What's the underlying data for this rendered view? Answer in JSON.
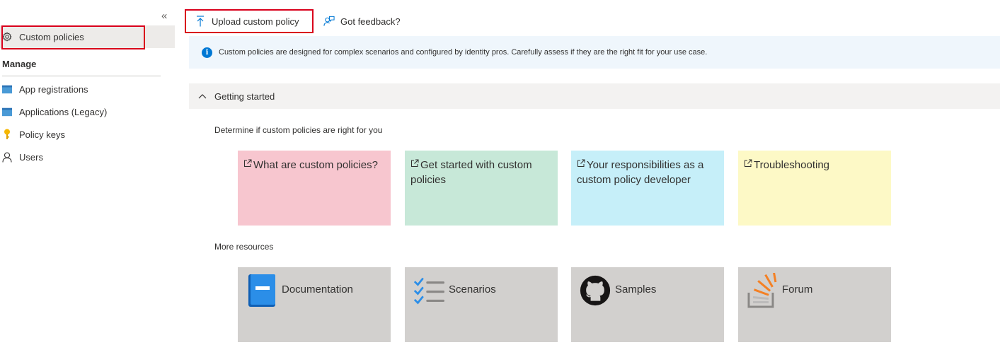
{
  "sidebar": {
    "collapse_label": "«",
    "active_item": {
      "label": "Custom policies",
      "icon": "gear-icon"
    },
    "manage_header": "Manage",
    "items": [
      {
        "label": "App registrations",
        "icon": "app-registrations-icon"
      },
      {
        "label": "Applications (Legacy)",
        "icon": "applications-legacy-icon"
      },
      {
        "label": "Policy keys",
        "icon": "key-icon"
      },
      {
        "label": "Users",
        "icon": "user-icon"
      }
    ]
  },
  "toolbar": {
    "upload_label": "Upload custom policy",
    "feedback_label": "Got feedback?"
  },
  "banner": {
    "icon_glyph": "i",
    "text": "Custom policies are designed for complex scenarios and configured by identity pros. Carefully assess if they are the right fit for your use case."
  },
  "section": {
    "title": "Getting started",
    "determine_label": "Determine if custom policies are right for you",
    "more_resources_label": "More resources"
  },
  "link_tiles": [
    {
      "label": "What are custom policies?",
      "color": "#f7c6cf"
    },
    {
      "label": "Get started with custom policies",
      "color": "#c7e8d8"
    },
    {
      "label": "Your responsibilities as a custom policy developer",
      "color": "#c6eff9"
    },
    {
      "label": "Troubleshooting",
      "color": "#fdf9c6"
    }
  ],
  "resource_tiles": [
    {
      "label": "Documentation",
      "icon": "book-icon"
    },
    {
      "label": "Scenarios",
      "icon": "checklist-icon"
    },
    {
      "label": "Samples",
      "icon": "github-icon"
    },
    {
      "label": "Forum",
      "icon": "stack-overflow-icon"
    }
  ],
  "colors": {
    "accent": "#0078d4",
    "highlight_border": "#d9001b",
    "banner_bg": "#eff6fc",
    "section_bg": "#f3f2f1",
    "resource_tile_bg": "#d2d0ce"
  }
}
